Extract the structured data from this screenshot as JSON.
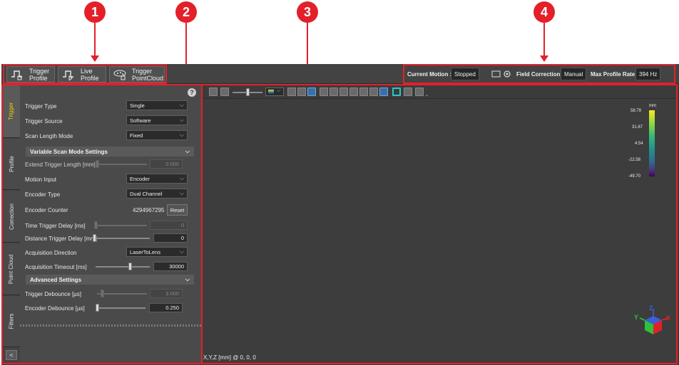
{
  "callouts": [
    "1",
    "2",
    "3",
    "4"
  ],
  "modes": [
    {
      "label": "Trigger\nProfile",
      "icon": "trigger-profile-icon"
    },
    {
      "label": "Live\nProfile",
      "icon": "live-profile-icon"
    },
    {
      "label": "Trigger\nPointCloud",
      "icon": "trigger-pointcloud-icon"
    }
  ],
  "status": {
    "current_motion_label": "Current Motion :",
    "current_motion_value": "Stopped",
    "field_correction_label": "Field Correction:",
    "field_correction_value": "Manual",
    "max_rate_label": "Max Profile Rate:",
    "max_rate_value": "394 Hz"
  },
  "tabs": [
    "Trigger",
    "Profile",
    "Correction",
    "Point Cloud",
    "Filters"
  ],
  "collapse_symbol": "<",
  "help_symbol": "?",
  "settings": {
    "trigger_type": {
      "label": "Trigger Type",
      "value": "Single"
    },
    "trigger_source": {
      "label": "Trigger Source",
      "value": "Software"
    },
    "scan_length_mode": {
      "label": "Scan Length Mode",
      "value": "Fixed"
    },
    "variable_section": "Variable Scan Mode Settings",
    "extend_trigger_length": {
      "label": "Extend Trigger Length [mm]",
      "value": "0.000"
    },
    "motion_input": {
      "label": "Motion Input",
      "value": "Encoder"
    },
    "encoder_type": {
      "label": "Encoder Type",
      "value": "Dual Channel"
    },
    "encoder_counter": {
      "label": "Encoder Counter",
      "value": "4294967295",
      "button": "Reset"
    },
    "time_trigger_delay": {
      "label": "Time Trigger Delay [ms]",
      "value": "0"
    },
    "distance_trigger_delay": {
      "label": "Distance Trigger Delay [mm]",
      "value": "0"
    },
    "acquisition_direction": {
      "label": "Acquisition Direction",
      "value": "LaserToLens"
    },
    "acquisition_timeout": {
      "label": "Acquisition Timeout [ms]",
      "value": "30000"
    },
    "advanced_section": "Advanced Settings",
    "trigger_debounce": {
      "label": "Trigger Debounce [µs]",
      "value": "3.000"
    },
    "encoder_debounce": {
      "label": "Encoder Debounce [µs]",
      "value": "0.250"
    }
  },
  "viewer": {
    "legend_unit": "mm",
    "legend_ticks": [
      "58.79",
      "31.67",
      "4.54",
      "-22.58",
      "-49.70"
    ],
    "coords": "X,Y,Z [mm] @ 0, 0, 0",
    "axis_x": "X",
    "axis_y": "Y",
    "axis_z": "Z"
  },
  "colors": {
    "accent_red": "#e3202a",
    "active_tab": "#f5d000"
  }
}
